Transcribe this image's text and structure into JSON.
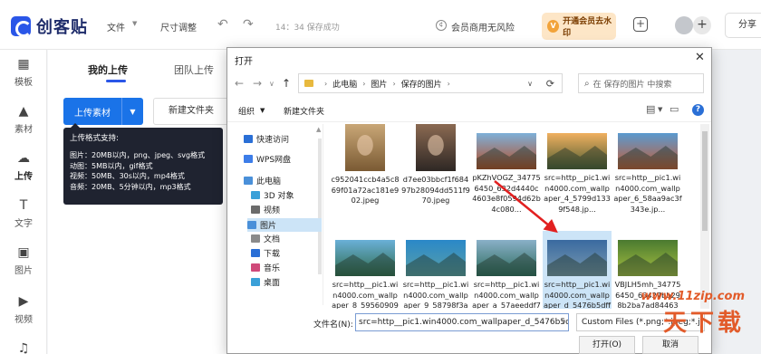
{
  "app": {
    "logo_text": "创客贴",
    "menu_file": "文件",
    "menu_resize": "尺寸调整",
    "save_status": "14：34 保存成功",
    "business_label": "会员商用无风险",
    "vip_badge": "V",
    "vip_button": "开通会员去水印",
    "share_button": "分享"
  },
  "sidebar": {
    "items": [
      {
        "label": "模板",
        "icon": "template-icon"
      },
      {
        "label": "素材",
        "icon": "shapes-icon"
      },
      {
        "label": "上传",
        "icon": "upload-cloud-icon"
      },
      {
        "label": "文字",
        "icon": "text-icon"
      },
      {
        "label": "图片",
        "icon": "image-icon"
      },
      {
        "label": "视频",
        "icon": "video-icon"
      }
    ]
  },
  "panel": {
    "tab_mine": "我的上传",
    "tab_team": "团队上传",
    "upload_button": "上传素材",
    "new_folder_button": "新建文件夹"
  },
  "tooltip": {
    "title": "上传格式支持:",
    "lines": [
      "图片：20MB以内，png、jpeg、svg格式",
      "动图：5MB以内，gif格式",
      "视频：50MB、30s以内，mp4格式",
      "音频：20MB、5分钟以内，mp3格式"
    ]
  },
  "dialog": {
    "title": "打开",
    "breadcrumb": [
      "此电脑",
      "图片",
      "保存的图片"
    ],
    "search_placeholder": "在 保存的图片 中搜索",
    "organize": "组织",
    "new_folder": "新建文件夹",
    "tree": [
      {
        "label": "快速访问",
        "icon": "star-icon",
        "color": "#2a6fd6"
      },
      {
        "label": "WPS网盘",
        "icon": "cloud-icon",
        "color": "#3d7de8"
      },
      {
        "label": "此电脑",
        "icon": "computer-icon",
        "color": "#4a90d9"
      },
      {
        "label": "3D 对象",
        "icon": "cube-icon",
        "color": "#3aa0d8"
      },
      {
        "label": "视频",
        "icon": "video-folder-icon",
        "color": "#6b6b6b"
      },
      {
        "label": "图片",
        "icon": "picture-folder-icon",
        "color": "#4a90d9"
      },
      {
        "label": "文档",
        "icon": "document-folder-icon",
        "color": "#8a8a8a"
      },
      {
        "label": "下载",
        "icon": "download-folder-icon",
        "color": "#2a6fd6"
      },
      {
        "label": "音乐",
        "icon": "music-folder-icon",
        "color": "#d04a7a"
      },
      {
        "label": "桌面",
        "icon": "desktop-folder-icon",
        "color": "#3aa0d8"
      }
    ],
    "files": [
      {
        "name": "c952041ccb4a5c869f01a72ac181e902.jpeg",
        "c1": "#c9a777",
        "c2": "#7a5a33"
      },
      {
        "name": "d7ee03bbcf1f68497b28094dd511f970.jpeg",
        "c1": "#8b6a52",
        "c2": "#2e2724"
      },
      {
        "name": "pKZhVOGZ_347756450_632d4440c4603e8f0594d62b4c080...",
        "c1": "#7db0d9",
        "c2": "#b84a20"
      },
      {
        "name": "src=http__pic1.win4000.com_wallpaper_4_5799d1339f548.jp...",
        "c1": "#f0b060",
        "c2": "#4a5a30"
      },
      {
        "name": "src=http__pic1.win4000.com_wallpaper_6_58aa9ac3f343e.jp...",
        "c1": "#5a9ad0",
        "c2": "#c85a30"
      },
      {
        "name": "src=http__pic1.win4000.com_wallpaper_8_59560909339d2.j...",
        "c1": "#6ab0d8",
        "c2": "#2e6a4a"
      },
      {
        "name": "src=http__pic1.win4000.com_wallpaper_9_58798f3a4d262.jp...",
        "c1": "#2a88c8",
        "c2": "#5aa0a8"
      },
      {
        "name": "src=http__pic1.win4000.com_wallpaper_a_57aeeddf717b5.j...",
        "c1": "#8ab0c8",
        "c2": "#2a6a5a"
      },
      {
        "name": "src=http__pic1.win4000.com_wallpaper_d_5476b5dff07a1.jp...",
        "c1": "#3a6aa0",
        "c2": "#7a9ab0"
      },
      {
        "name": "VBJLH5mh_347756450_63427bb298b2ba7ad844638...",
        "c1": "#4a7a30",
        "c2": "#a8c040"
      }
    ],
    "filename_label": "文件名(N):",
    "filename_value": "src=http__pic1.win4000.com_wallpaper_d_5476b5dff07a1.jpg",
    "filter_value": "Custom Files (*.png;*.jpeg;*.j",
    "open_button": "打开(O)",
    "cancel_button": "取消"
  },
  "watermark": {
    "url": "www.11zip.com",
    "text": "天下载"
  }
}
